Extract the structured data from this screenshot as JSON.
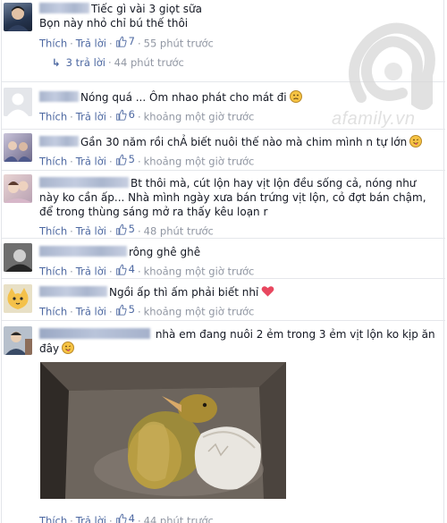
{
  "comments": [
    {
      "text": "Tiếc gì vài 3 giọt sữa",
      "text2": "Bọn này nhỏ chỉ bú thế thôi",
      "like_label": "Thích",
      "reply_label": "Trả lời",
      "like_count": "7",
      "time": "55 phút trước",
      "replies_label": "3 trả lời",
      "replies_time": "44 phút trước"
    },
    {
      "text": "Nóng quá ... Ôm nhao phát cho mát đi",
      "like_label": "Thích",
      "reply_label": "Trả lời",
      "like_count": "6",
      "time": "khoảng một giờ trước"
    },
    {
      "text": "Gần 30 năm rồi chẢ biết nuôi thế nào mà chim mình n tự lớn",
      "like_label": "Thích",
      "reply_label": "Trả lời",
      "like_count": "5",
      "time": "khoảng một giờ trước"
    },
    {
      "text": "Bt thôi mà, cút lộn hay vịt lộn đều sống cả, nóng như này ko cần ấp... Nhà mình ngày xưa bán trứng vịt lộn, cỏ đợt bán chậm, để trong thùng sáng mở ra thấy kêu loạn r",
      "like_label": "Thích",
      "reply_label": "Trả lời",
      "like_count": "5",
      "time": "48 phút trước"
    },
    {
      "text": "rông ghê ghê",
      "like_label": "Thích",
      "reply_label": "Trả lời",
      "like_count": "4",
      "time": "khoảng một giờ trước"
    },
    {
      "text": "Ngồi ấp thì ấm phải biết nhỉ",
      "like_label": "Thích",
      "reply_label": "Trả lời",
      "like_count": "5",
      "time": "khoảng một giờ trước"
    },
    {
      "text": "nhà em đang nuôi 2 ẻm trong 3 ẻm vịt lộn ko kịp ăn đây",
      "blurred_name": "Thị Thương Thương",
      "like_label": "Thích",
      "reply_label": "Trả lời",
      "like_count": "4",
      "time": "44 phút trước"
    }
  ],
  "watermark": {
    "text": "afamily.vn",
    "color": "#d9d9d9"
  },
  "colors": {
    "link": "#4e69a2",
    "meta": "#9197a3",
    "text": "#141823",
    "emoji": "#f6c343",
    "heart": "#e8475f"
  }
}
